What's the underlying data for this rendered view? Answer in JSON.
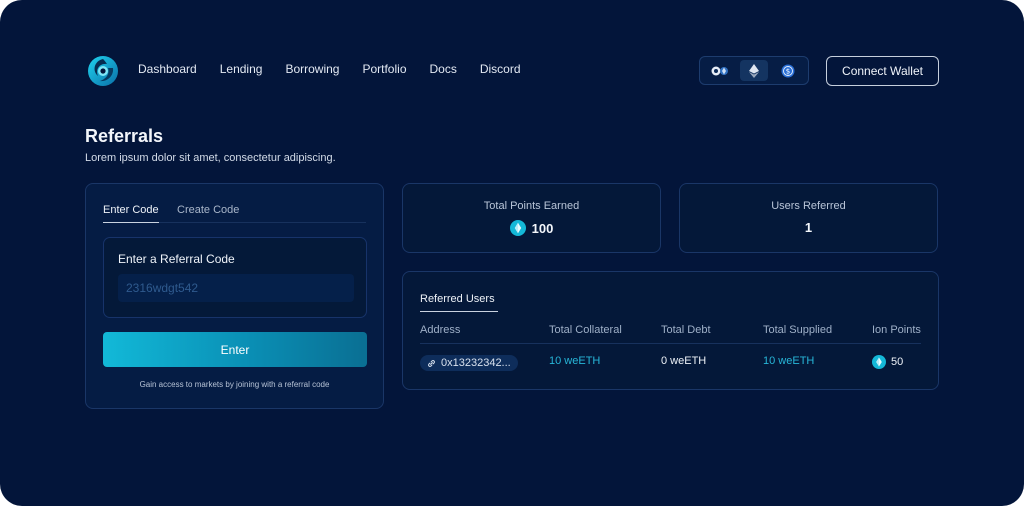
{
  "brand": {
    "logo_icon": "swirl-logo-icon",
    "accent": "#12b9d8"
  },
  "nav": {
    "items": [
      {
        "label": "Dashboard"
      },
      {
        "label": "Lending"
      },
      {
        "label": "Borrowing"
      },
      {
        "label": "Portfolio"
      },
      {
        "label": "Docs"
      },
      {
        "label": "Discord"
      }
    ]
  },
  "chain_switcher": {
    "options": [
      {
        "icon": "multichain-icon"
      },
      {
        "icon": "ethereum-icon",
        "selected": true
      },
      {
        "icon": "usdc-icon"
      }
    ]
  },
  "header": {
    "connect_label": "Connect Wallet"
  },
  "page": {
    "title": "Referrals",
    "subtitle": "Lorem ipsum dolor sit amet, consectetur adipiscing."
  },
  "code_panel": {
    "tabs": [
      {
        "label": "Enter Code",
        "active": true
      },
      {
        "label": "Create Code"
      }
    ],
    "field_label": "Enter a Referral Code",
    "placeholder": "2316wdgt542",
    "button_label": "Enter",
    "hint": "Gain access to markets by joining with a referral code"
  },
  "stats": {
    "points": {
      "label": "Total Points Earned",
      "value": "100",
      "icon": "ion-token-icon"
    },
    "users": {
      "label": "Users Referred",
      "value": "1"
    }
  },
  "referred_users": {
    "tab_label": "Referred Users",
    "columns": [
      "Address",
      "Total Collateral",
      "Total Debt",
      "Total Supplied",
      "Ion Points"
    ],
    "rows": [
      {
        "address": "0x13232342...",
        "collateral": "10 weETH",
        "debt": "0 weETH",
        "supplied": "10 weETH",
        "points": "50"
      }
    ]
  }
}
